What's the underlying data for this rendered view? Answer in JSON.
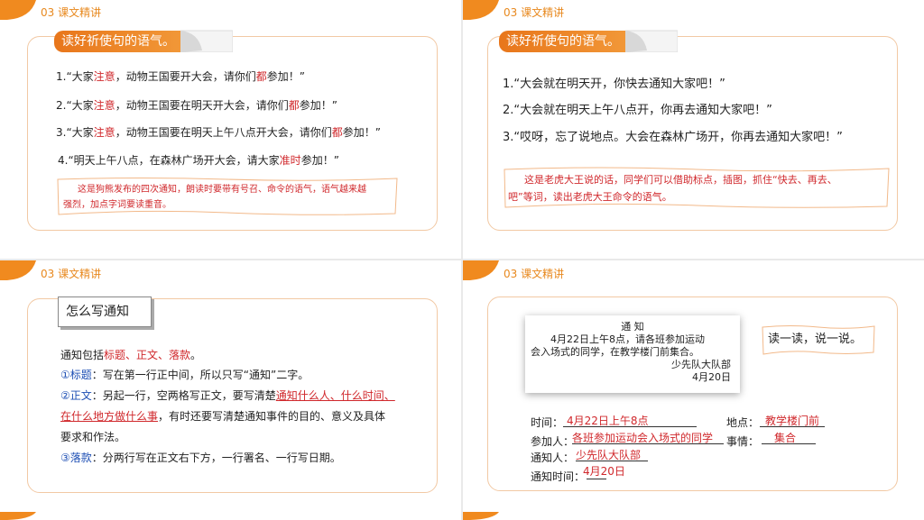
{
  "section_label": "03  课文精讲",
  "colors": {
    "accent": "#e8761b",
    "red": "#d0282c",
    "blue": "#1e4fb4",
    "border": "#f2c9a4"
  },
  "slide1": {
    "ribbon": "读好祈使句的语气。",
    "lines": [
      {
        "n": "1.",
        "a": "“大家",
        "r1": "注意",
        "b": "，动物王国要开大会，请你们",
        "r2": "都",
        "c": "参加！”"
      },
      {
        "n": "2.",
        "a": "“大家",
        "r1": "注意",
        "b": "，动物王国要在明天开大会，请你们",
        "r2": "都",
        "c": "参加！”"
      },
      {
        "n": "3.",
        "a": "“大家",
        "r1": "注意",
        "b": "，动物王国要在明天上午八点开大会，请你们",
        "r2": "都",
        "c": "参加！”"
      },
      {
        "n": "4.",
        "a": "“明天上午八点，在森林广场开大会，请大家",
        "r1": "准时",
        "b": "参加！”",
        "r2": "",
        "c": ""
      }
    ],
    "note_l1": "这是狗熊发布的四次通知，朗读时要带有号召、命令的语气，语气越来越",
    "note_l2": "强烈，加点字词要读重音。"
  },
  "slide2": {
    "ribbon": "读好祈使句的语气。",
    "lines": [
      "1.“大会就在明天开，你快去通知大家吧！”",
      "2.“大会就在明天上午八点开，你再去通知大家吧！”",
      "3.“哎呀，忘了说地点。大会在森林广场开，你再去通知大家吧！”"
    ],
    "note_l1": "这是老虎大王说的话，同学们可以借助标点，插图，抓住“快去、再去、",
    "note_l2": "吧”等词，读出老虎大王命令的语气。"
  },
  "slide3": {
    "title": "怎么写通知",
    "intro_a": "通知包括",
    "intro_r": "标题、正文、落款",
    "intro_b": "。",
    "item1_label": "①标题",
    "item1_text": "：写在第一行正中间，所以只写“通知”二字。",
    "item2_label": "②正文",
    "item2_a": "：另起一行，空两格写正文，要写清楚",
    "item2_r1": "通知什么人、什么时间、",
    "item2_r2": "在什么地方做什么事",
    "item2_b": "，有时还要写清楚通知事件的目的、意义及具体",
    "item2_c": "要求和作法。",
    "item3_label": "③落款",
    "item3_text": "：分两行写在正文右下方，一行署名、一行写日期。"
  },
  "slide4": {
    "notice_title": "通  知",
    "notice_l1": "4月22日上午8点，请各班参加运动",
    "notice_l2": "会入场式的同学，在教学楼门前集合。",
    "notice_sign": "少先队大队部",
    "notice_date": "4月20日",
    "read_label": "读一读，说一说。",
    "time_label": "时间：",
    "time_value": "4月22日上午8点",
    "place_label": "地点：",
    "place_value": "教学楼门前",
    "who_label": "参加人：",
    "who_value": "各班参加运动会入场式的同学",
    "event_label": "事情：",
    "event_value": "集合",
    "notifier_label": "通知人：",
    "notifier_value": "少先队大队部",
    "ntime_label": "通知时间：",
    "ntime_value": "4月20日"
  }
}
